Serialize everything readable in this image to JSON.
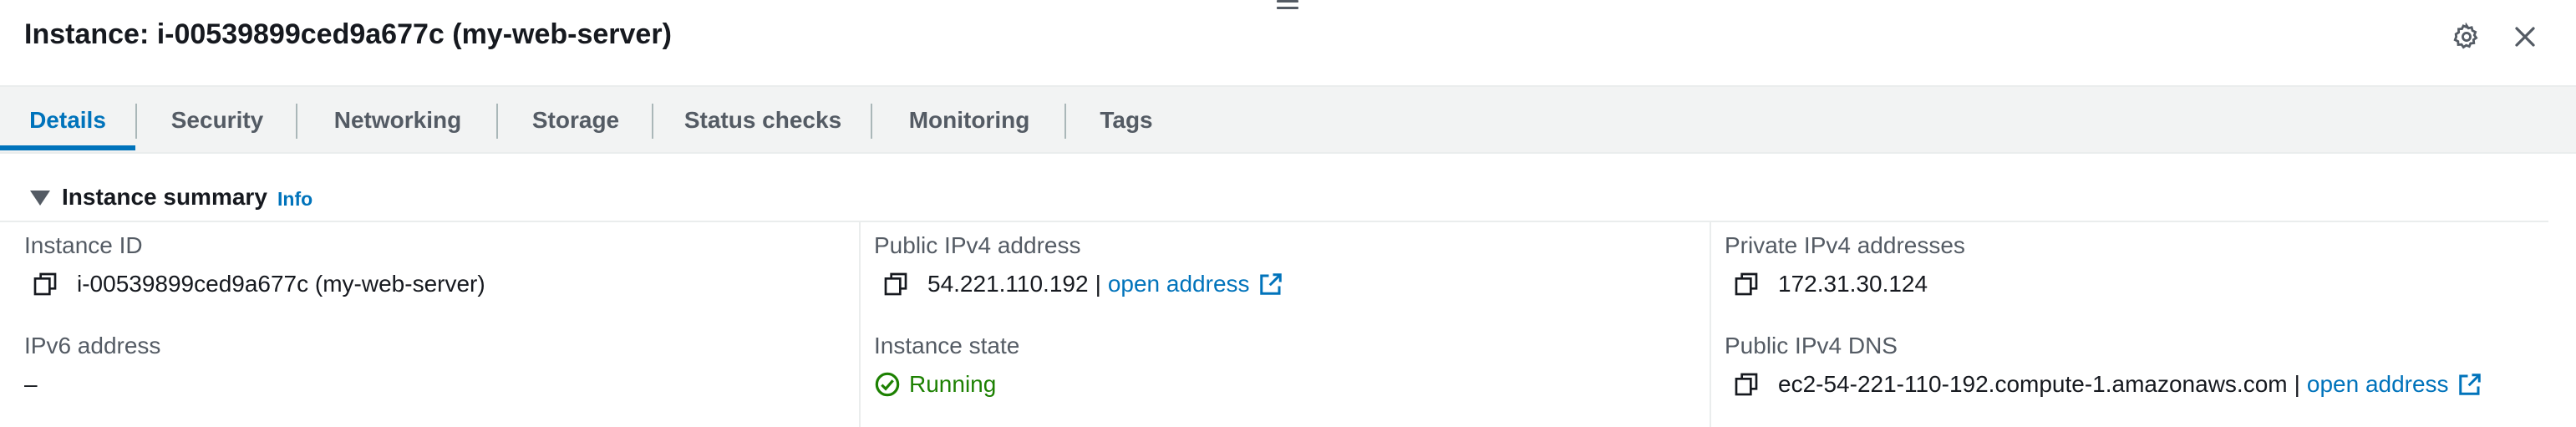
{
  "header": {
    "title": "Instance: i-00539899ced9a677c (my-web-server)"
  },
  "icons": {
    "settings": "gear-icon",
    "close": "close-icon",
    "drag": "drag-handle-icon",
    "copy": "copy-icon",
    "external": "external-link-icon",
    "status_ok": "check-circle-icon"
  },
  "colors": {
    "accent": "#0073bb",
    "success": "#1d8102",
    "text": "#16191f",
    "muted": "#545b64"
  },
  "tabs": [
    {
      "label": "Details",
      "active": true
    },
    {
      "label": "Security",
      "active": false
    },
    {
      "label": "Networking",
      "active": false
    },
    {
      "label": "Storage",
      "active": false
    },
    {
      "label": "Status checks",
      "active": false
    },
    {
      "label": "Monitoring",
      "active": false
    },
    {
      "label": "Tags",
      "active": false
    }
  ],
  "summary": {
    "title": "Instance summary",
    "info_link": "Info",
    "fields": {
      "instance_id": {
        "label": "Instance ID",
        "value": "i-00539899ced9a677c (my-web-server)"
      },
      "public_ipv4": {
        "label": "Public IPv4 address",
        "value": "54.221.110.192",
        "separator": "|",
        "link": "open address"
      },
      "private_ipv4": {
        "label": "Private IPv4 addresses",
        "value": "172.31.30.124"
      },
      "ipv6": {
        "label": "IPv6 address",
        "value": "–"
      },
      "state": {
        "label": "Instance state",
        "value": "Running"
      },
      "public_dns": {
        "label": "Public IPv4 DNS",
        "value": "ec2-54-221-110-192.compute-1.amazonaws.com",
        "separator": "|",
        "link": "open address"
      }
    }
  }
}
